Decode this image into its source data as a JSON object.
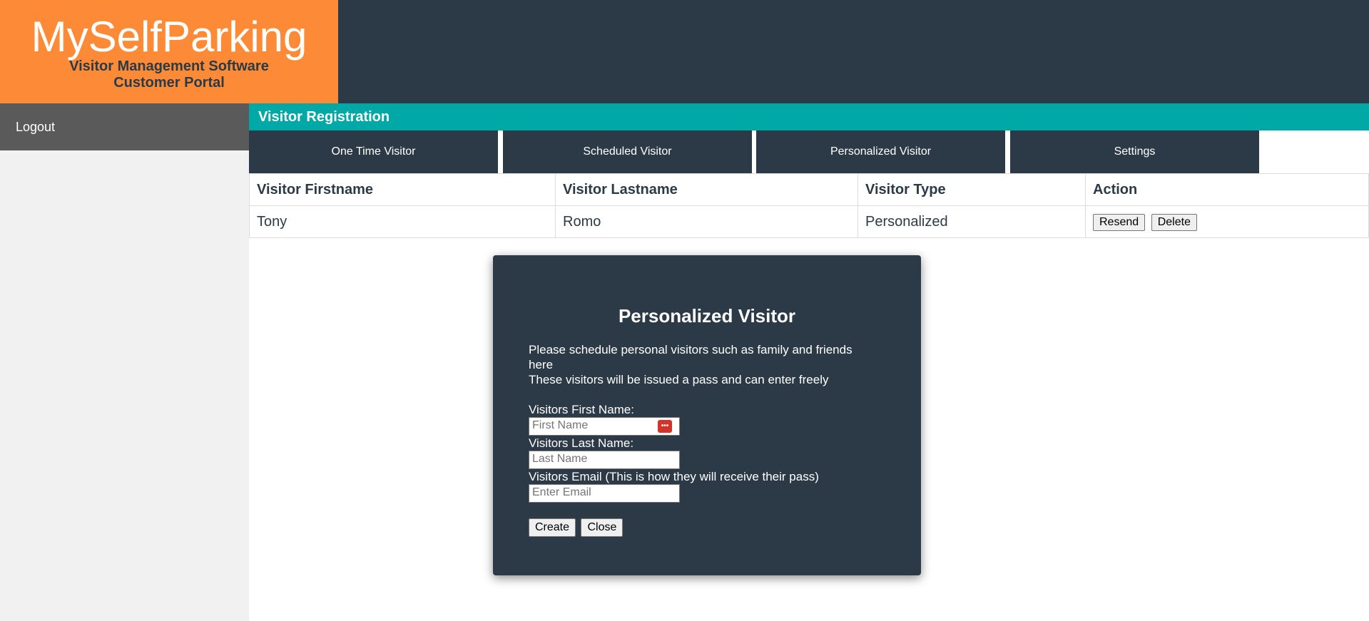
{
  "header": {
    "logo_title": "MySelfParking",
    "logo_subtitle_1": "Visitor Management Software",
    "logo_subtitle_2": "Customer Portal"
  },
  "colors": {
    "brand_orange": "#fd8a36",
    "dark_navy": "#2c3a47",
    "teal": "#00a9a6",
    "sidebar_gray": "#5a5a5a"
  },
  "sidebar": {
    "items": [
      {
        "label": "Logout"
      }
    ]
  },
  "main": {
    "section_title": "Visitor Registration",
    "tabs": [
      {
        "label": "One Time Visitor"
      },
      {
        "label": "Scheduled Visitor"
      },
      {
        "label": "Personalized Visitor"
      },
      {
        "label": "Settings"
      }
    ],
    "table": {
      "columns": [
        "Visitor Firstname",
        "Visitor Lastname",
        "Visitor Type",
        "Action"
      ],
      "rows": [
        {
          "firstname": "Tony",
          "lastname": "Romo",
          "type": "Personalized",
          "actions": [
            "Resend",
            "Delete"
          ]
        }
      ]
    }
  },
  "modal": {
    "title": "Personalized Visitor",
    "desc_line_1": "Please schedule personal visitors such as family and friends here",
    "desc_line_2": "These visitors will be issued a pass and can enter freely",
    "first_name_label": "Visitors First Name:",
    "first_name_placeholder": "First Name",
    "first_name_value": "",
    "password_manager_icon": "password-manager-icon",
    "last_name_label": "Visitors Last Name:",
    "last_name_placeholder": "Last Name",
    "last_name_value": "",
    "email_label": "Visitors Email (This is how they will receive their pass)",
    "email_placeholder": "Enter Email",
    "email_value": "",
    "create_label": "Create",
    "close_label": "Close"
  }
}
